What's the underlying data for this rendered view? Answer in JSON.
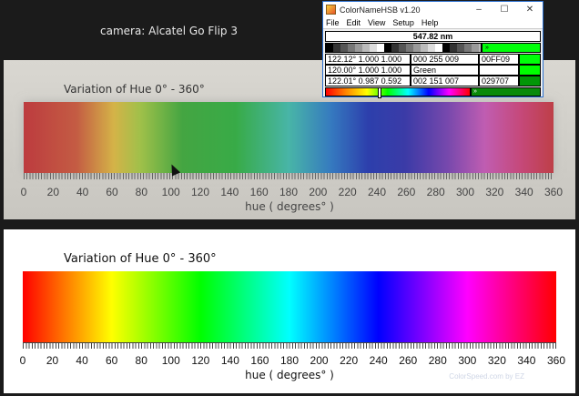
{
  "caption": {
    "text": "camera:  Alcatel Go Flip 3"
  },
  "photo": {
    "title": "Variation of Hue  0° - 360°",
    "ticks": [
      "0",
      "20",
      "40",
      "60",
      "80",
      "100",
      "120",
      "140",
      "160",
      "180",
      "200",
      "220",
      "240",
      "260",
      "280",
      "300",
      "320",
      "340",
      "360"
    ],
    "axis_label": "hue  ( degrees° )"
  },
  "clean": {
    "title": "Variation of Hue  0° - 360°",
    "ticks": [
      "0",
      "20",
      "40",
      "60",
      "80",
      "100",
      "120",
      "140",
      "160",
      "180",
      "200",
      "220",
      "240",
      "260",
      "280",
      "300",
      "320",
      "340",
      "360"
    ],
    "axis_label": "hue  ( degrees° )",
    "credit": "ColorSpeed.com by EZ"
  },
  "app": {
    "title": "ColorNameHSB  v1.20",
    "menu": [
      "File",
      "Edit",
      "View",
      "Setup",
      "Help"
    ],
    "wavelength": "547.82 nm",
    "swatch_marker": "»",
    "rows": [
      {
        "hsb": "122.12° 1.000  1.000",
        "rgb": "000  255  009",
        "hex": "00FF09",
        "swatch_color": "#00ff09"
      },
      {
        "hsb": "120.00° 1.000  1.000",
        "name": "Green",
        "swatch_color": "#00ff00"
      },
      {
        "hsb": "122.01° 0.987  0.592",
        "rgb": "002  151  007",
        "hex": "029707",
        "swatch_color": "#029707"
      }
    ],
    "bottom_marker": "»",
    "colors": {
      "accent": "#2a6fd0",
      "match_green": "#00ff09"
    }
  }
}
